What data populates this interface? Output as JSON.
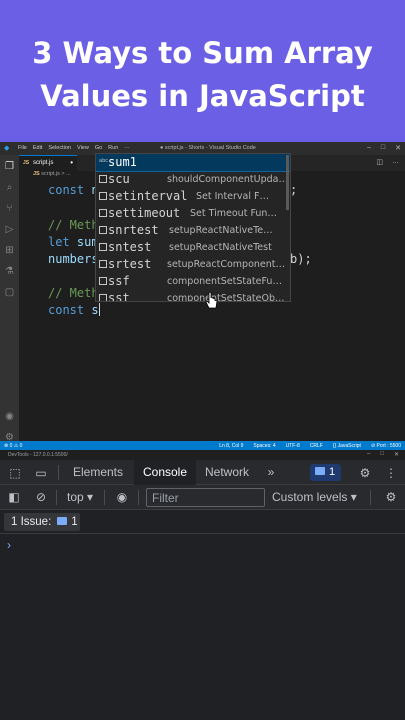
{
  "banner": {
    "line1": "3 Ways to Sum Array",
    "line2": "Values in JavaScript",
    "background": "#6b5fe6"
  },
  "vscode": {
    "menu": [
      "File",
      "Edit",
      "Selection",
      "View",
      "Go",
      "Run",
      "···"
    ],
    "window_title": "● script.js - Shorts - Visual Studio Code",
    "tab": {
      "icon": "JS",
      "label": "script.js"
    },
    "breadcrumb": {
      "icon": "JS",
      "label": "script.js > ..."
    },
    "code": {
      "l1_kw": "const",
      "l1_rest": " n",
      "l1_end": ";",
      "l2": "// Meth",
      "l3_kw": "let",
      "l3_rest": " sum",
      "l4_var": "numbers",
      "l4_end": "b);",
      "l5": "// Meth",
      "l6_kw": "const",
      "l6_rest": " s"
    },
    "suggestions": [
      {
        "label": "sum1",
        "detail": "",
        "selected": true,
        "kind": "abc"
      },
      {
        "label": "scu",
        "detail": "shouldComponentUpda…"
      },
      {
        "label": "setinterval",
        "detail": "Set Interval F…"
      },
      {
        "label": "settimeout",
        "detail": "Set Timeout Fun…"
      },
      {
        "label": "snrtest",
        "detail": "setupReactNativeTe…"
      },
      {
        "label": "sntest",
        "detail": "setupReactNativeTest"
      },
      {
        "label": "srtest",
        "detail": "setupReactComponent…"
      },
      {
        "label": "ssf",
        "detail": "componentSetStateFu…"
      },
      {
        "label": "sst",
        "detail": "componentSetStateOb…"
      }
    ],
    "status": {
      "left": "⊗ 0 ⚠ 0",
      "right": [
        "Ln 8, Col 9",
        "Spaces: 4",
        "UTF-8",
        "CRLF",
        "{} JavaScript",
        "⊘ Port : 5500"
      ]
    }
  },
  "devtools": {
    "window_title": "DevTools - 127.0.0.1:5500/",
    "tabs": [
      "Elements",
      "Console",
      "Network"
    ],
    "active_tab": "Console",
    "more_tabs": "»",
    "issues_count": "1",
    "context": "top",
    "filter_placeholder": "Filter",
    "levels": "Custom levels",
    "issues_label": "1 Issue:",
    "issues_chip_count": "1",
    "prompt": "›"
  }
}
